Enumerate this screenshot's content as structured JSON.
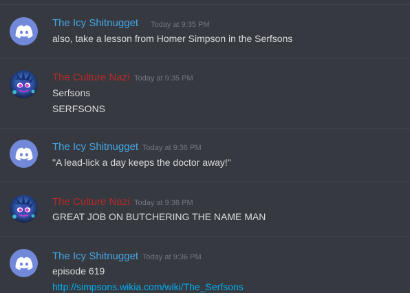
{
  "messages": [
    {
      "author": "The Icy Shitnugget",
      "author_color": "#46a7e6",
      "timestamp": "Today at 9:35 PM",
      "lines": [
        "also, take a lesson from Homer Simpson in the Serfsons"
      ],
      "avatar": "discord-logo-icon"
    },
    {
      "author": "The Culture Nazi",
      "author_color": "#b72a2a",
      "timestamp": "Today at 9:35 PM",
      "lines": [
        "Serfsons",
        "SERFSONS"
      ],
      "avatar": "custom-character-avatar"
    },
    {
      "author": "The Icy Shitnugget",
      "author_color": "#46a7e6",
      "timestamp": "Today at 9:36 PM",
      "lines": [
        "\"A lead-lick a day keeps the doctor away!\""
      ],
      "avatar": "discord-logo-icon"
    },
    {
      "author": "The Culture Nazi",
      "author_color": "#b72a2a",
      "timestamp": "Today at 9:36 PM",
      "lines": [
        "GREAT JOB ON BUTCHERING THE NAME MAN"
      ],
      "avatar": "custom-character-avatar"
    },
    {
      "author": "The Icy Shitnugget",
      "author_color": "#46a7e6",
      "timestamp": "Today at 9:36 PM",
      "lines": [
        "episode 619"
      ],
      "link": "http://simpsons.wikia.com/wiki/The_Serfsons",
      "avatar": "discord-logo-icon"
    }
  ],
  "colors": {
    "background": "#36393f",
    "divider": "#41444a",
    "text": "#dcddde",
    "timestamp": "#72767d",
    "link": "#00b0f4",
    "discord_blurple": "#7289da"
  }
}
